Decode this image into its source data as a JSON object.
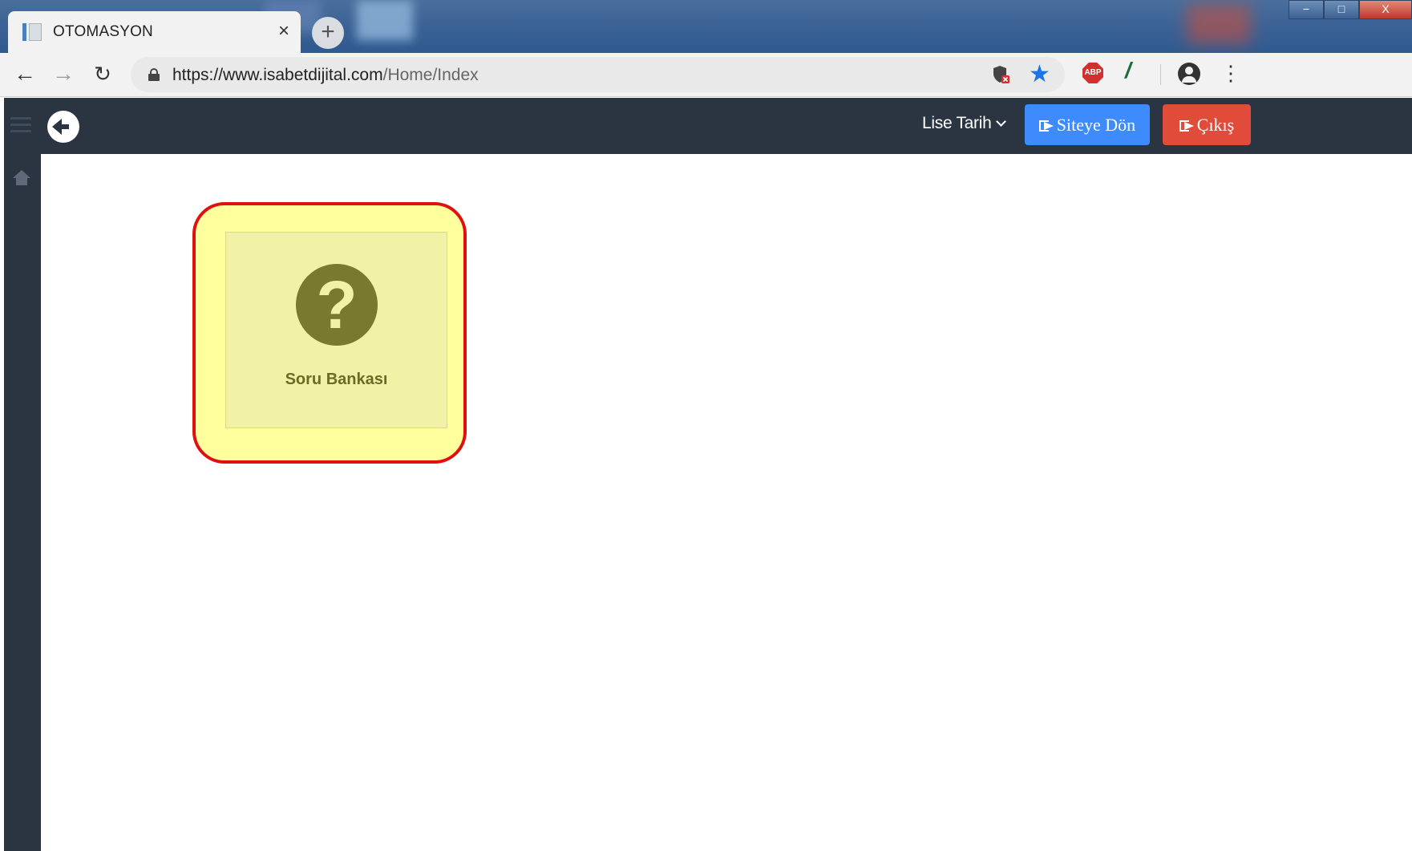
{
  "browser": {
    "tab_title": "OTOMASYON",
    "tab_close": "×",
    "new_tab": "+",
    "url_host": "https://www.isabetdijital.com",
    "url_path": "/Home/Index",
    "abp_label": "ABP",
    "window_controls": {
      "minimize": "−",
      "maximize": "□",
      "close": "X"
    }
  },
  "header": {
    "menu_label": "Lise Tarih",
    "siteye_don_label": "Siteye Dön",
    "cikis_label": "Çıkış"
  },
  "main": {
    "card_label": "Soru Bankası",
    "card_icon_glyph": "?"
  },
  "colors": {
    "header_bg": "#2b3542",
    "siteye_don": "#3d8bfd",
    "cikis": "#e04b3a",
    "highlight_border": "#e01010",
    "highlight_fill": "#ffff9e",
    "card_icon": "#7a7a2e"
  }
}
